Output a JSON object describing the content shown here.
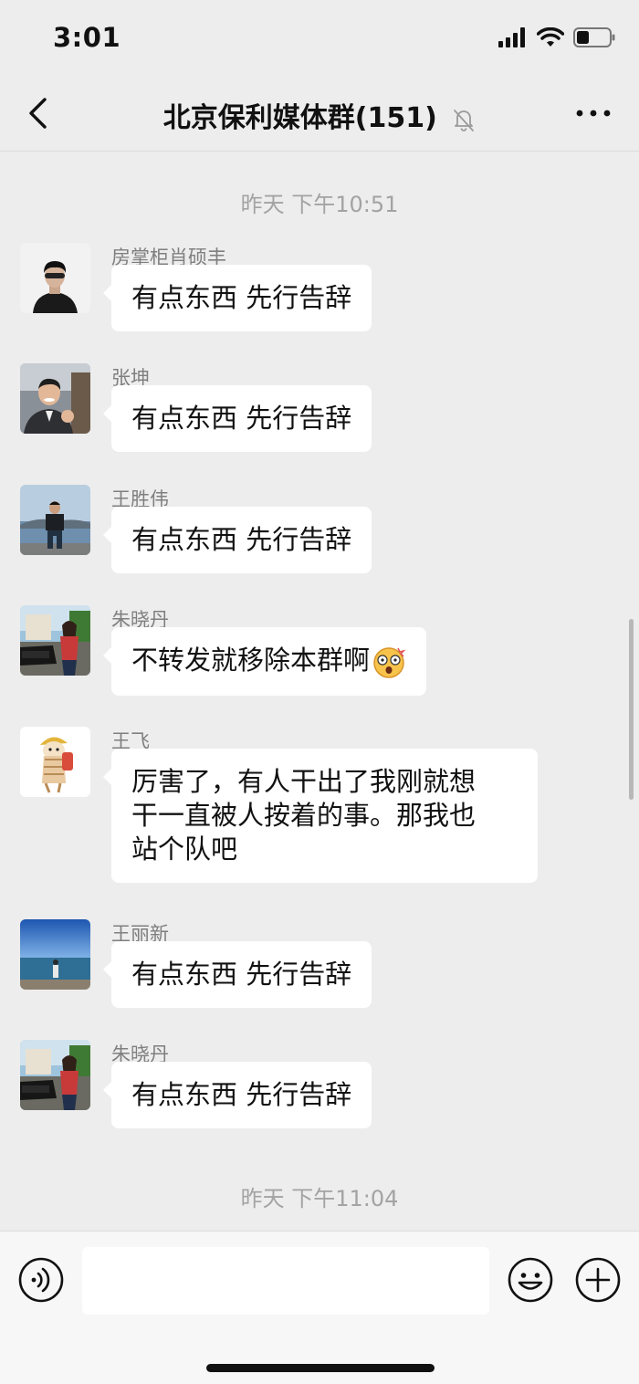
{
  "status_bar": {
    "time": "3:01"
  },
  "nav": {
    "title": "北京保利媒体群(151)"
  },
  "timestamps": [
    "昨天 下午10:51",
    "昨天 下午11:04"
  ],
  "messages": [
    {
      "sender": "房掌柜肖硕丰",
      "text": "有点东西 先行告辞"
    },
    {
      "sender": "张坤",
      "text": "有点东西 先行告辞"
    },
    {
      "sender": "王胜伟",
      "text": "有点东西 先行告辞"
    },
    {
      "sender": "朱晓丹",
      "text": "不转发就移除本群啊",
      "emoji": "😲"
    },
    {
      "sender": "王飞",
      "text_lines": [
        "厉害了，有人干出了我刚就想",
        "干一直被人按着的事。那我也",
        "站个队吧"
      ]
    },
    {
      "sender": "王丽新",
      "text": "有点东西 先行告辞"
    },
    {
      "sender": "朱晓丹",
      "text": "有点东西 先行告辞"
    }
  ],
  "input": {
    "placeholder": ""
  },
  "colors": {
    "background": "#ededed",
    "bubble": "#ffffff",
    "meta_text": "#a3a3a3"
  }
}
